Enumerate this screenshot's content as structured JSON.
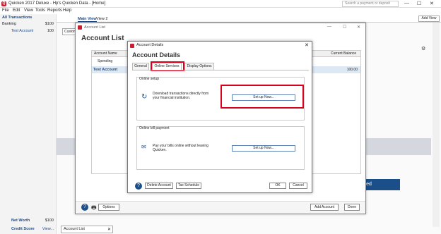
{
  "window": {
    "title": "Quicken 2017 Deluxe - Hp's Quicken Data - [Home]",
    "search_placeholder": "Search a payment or deposit",
    "minimize": "—",
    "maximize": "☐",
    "close": "✕"
  },
  "menu": [
    "File",
    "Edit",
    "View",
    "Tools",
    "Reports",
    "Help"
  ],
  "sidebar": {
    "all_transactions": "All Transactions",
    "banking_label": "Banking",
    "banking_amount": "$100",
    "test_account_label": "Test Account",
    "test_account_amount": "100",
    "net_worth_label": "Net Worth",
    "net_worth_amount": "$100",
    "credit_score_label": "Credit Score",
    "credit_score_link": "View..."
  },
  "main": {
    "tabs": [
      "Main View",
      "View 2"
    ],
    "add_view": "Add View",
    "customize": "Custom",
    "started_button": "tarted",
    "bottom_tab": "Account List"
  },
  "account_list": {
    "window_title": "Account List",
    "heading": "Account List",
    "col_name": "Account Name",
    "col_balance": "Current Balance",
    "group_spending": "Spending",
    "account_name": "Test Account",
    "account_balance": "100.00",
    "options": "Options",
    "add_account": "Add Account",
    "done": "Done"
  },
  "dialog": {
    "window_title": "Account Details",
    "heading": "Account Details",
    "tabs": [
      "General",
      "Online Services",
      "Display Options"
    ],
    "online_setup_title": "Online setup",
    "download_text": "Download transactions directly from your financial institution.",
    "setup_now": "Set up Now...",
    "bill_payment_title": "Online bill payment",
    "bill_text": "Pay your bills online without leaving Quicken.",
    "setup_now_2": "Set up Now...",
    "help": "?",
    "delete_account": "Delete Account",
    "tax_schedule": "Tax Schedule",
    "ok": "OK",
    "cancel": "Cancel"
  },
  "colors": {
    "brand_red": "#c8202f",
    "accent_blue": "#1b4f8a",
    "highlight_red": "#d8001a"
  }
}
